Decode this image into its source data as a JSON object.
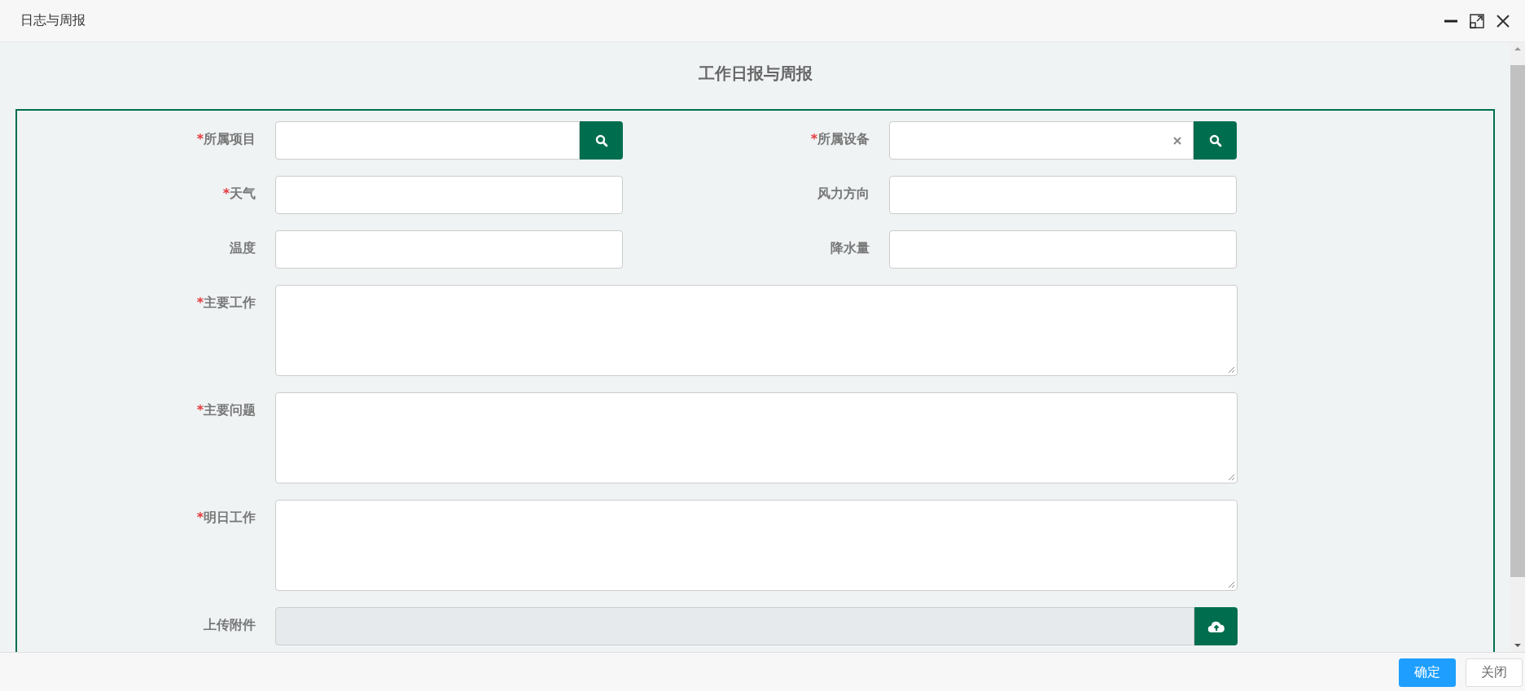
{
  "window": {
    "title": "日志与周报"
  },
  "heading": "工作日报与周报",
  "rows": [
    [
      {
        "mark": "*",
        "label": "所属项目",
        "kind": "lookup",
        "clearable": false
      },
      {
        "mark": "*",
        "label": "所属设备",
        "kind": "lookup",
        "clearable": true
      }
    ],
    [
      {
        "mark": "*",
        "label": "天气",
        "kind": "text"
      },
      {
        "label": "风力方向",
        "kind": "text"
      }
    ],
    [
      {
        "label": "温度",
        "kind": "text"
      },
      {
        "label": "降水量",
        "kind": "text"
      }
    ],
    [
      {
        "mark": "*",
        "label": "主要工作",
        "kind": "textarea"
      }
    ],
    [
      {
        "mark": "*",
        "label": "主要问题",
        "kind": "textarea"
      }
    ],
    [
      {
        "mark": "*",
        "label": "明日工作",
        "kind": "textarea"
      }
    ],
    [
      {
        "label": "上传附件",
        "kind": "upload"
      }
    ]
  ],
  "buttons": [
    {
      "label": "确定",
      "kind": "primary"
    },
    {
      "label": "关闭",
      "kind": "default"
    }
  ]
}
